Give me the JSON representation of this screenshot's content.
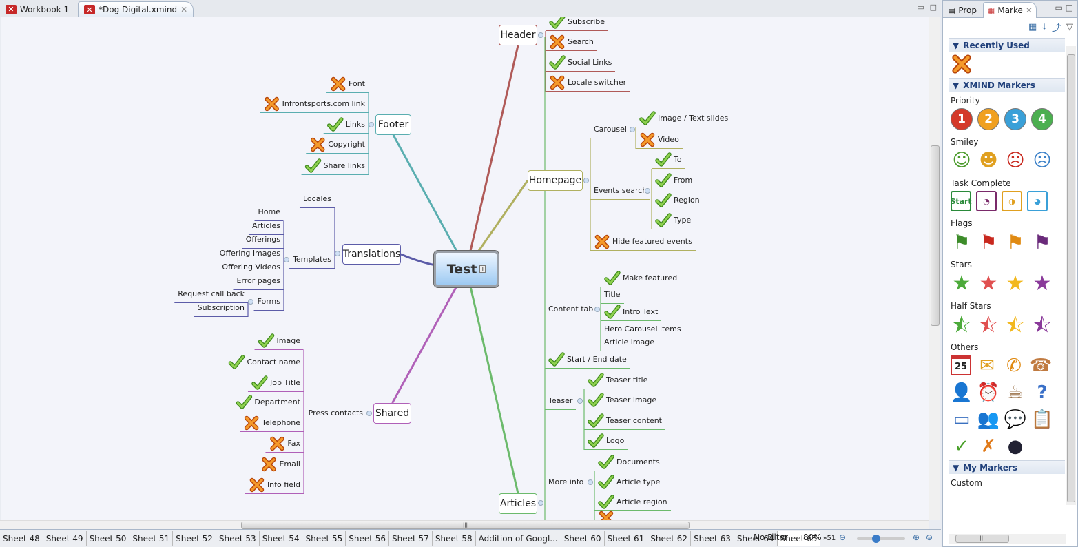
{
  "editor_tabs": [
    {
      "label": "Workbook 1",
      "active": false
    },
    {
      "label": "*Dog Digital.xmind",
      "active": true
    }
  ],
  "map": {
    "central": "Test",
    "branches": [
      {
        "id": "header",
        "label": "Header",
        "color": "#b05a58"
      },
      {
        "id": "footer",
        "label": "Footer",
        "color": "#5aaeb0"
      },
      {
        "id": "homepage",
        "label": "Homepage",
        "color": "#b0b060"
      },
      {
        "id": "translations",
        "label": "Translations",
        "color": "#5c5ca8"
      },
      {
        "id": "shared",
        "label": "Shared",
        "color": "#b060b8"
      },
      {
        "id": "articles",
        "label": "Articles",
        "color": "#6cba6c"
      }
    ],
    "nodes": {
      "h1": {
        "text": "Subscribe",
        "marker": "check"
      },
      "h2": {
        "text": "Search",
        "marker": "cross"
      },
      "h3": {
        "text": "Social Links",
        "marker": "check"
      },
      "h4": {
        "text": "Locale switcher",
        "marker": "cross"
      },
      "f1": {
        "text": "Font",
        "marker": "cross"
      },
      "f2": {
        "text": "Infrontsports.com link",
        "marker": "cross"
      },
      "f3": {
        "text": "Links",
        "marker": "check"
      },
      "f4": {
        "text": "Copyright",
        "marker": "cross"
      },
      "f5": {
        "text": "Share links",
        "marker": "check"
      },
      "hp_car": {
        "text": "Carousel",
        "marker": ""
      },
      "hp_c1": {
        "text": "Image / Text slides",
        "marker": "check"
      },
      "hp_c2": {
        "text": "Video",
        "marker": "cross"
      },
      "hp_ev": {
        "text": "Events search",
        "marker": ""
      },
      "hp_e1": {
        "text": "To",
        "marker": "check"
      },
      "hp_e2": {
        "text": "From",
        "marker": "check"
      },
      "hp_e3": {
        "text": "Region",
        "marker": "check"
      },
      "hp_e4": {
        "text": "Type",
        "marker": "check"
      },
      "hp_hide": {
        "text": "Hide featured events",
        "marker": "cross"
      },
      "t_loc": {
        "text": "Locales",
        "marker": ""
      },
      "t_tpl": {
        "text": "Templates",
        "marker": ""
      },
      "t1": {
        "text": "Home",
        "marker": ""
      },
      "t2": {
        "text": "Articles",
        "marker": ""
      },
      "t3": {
        "text": "Offerings",
        "marker": ""
      },
      "t4": {
        "text": "Offering Images",
        "marker": ""
      },
      "t5": {
        "text": "Offering Videos",
        "marker": ""
      },
      "t6": {
        "text": "Error pages",
        "marker": ""
      },
      "t_forms": {
        "text": "Forms",
        "marker": ""
      },
      "tf1": {
        "text": "Request call back",
        "marker": ""
      },
      "tf2": {
        "text": "Subscription",
        "marker": ""
      },
      "s_pc": {
        "text": "Press contacts",
        "marker": ""
      },
      "s1": {
        "text": "Image",
        "marker": "check"
      },
      "s2": {
        "text": "Contact name",
        "marker": "check"
      },
      "s3": {
        "text": "Job Title",
        "marker": "check"
      },
      "s4": {
        "text": "Department",
        "marker": "check"
      },
      "s5": {
        "text": "Telephone",
        "marker": "cross"
      },
      "s6": {
        "text": "Fax",
        "marker": "cross"
      },
      "s7": {
        "text": "Email",
        "marker": "cross"
      },
      "s8": {
        "text": "Info field",
        "marker": "cross"
      },
      "a_ct": {
        "text": "Content tab",
        "marker": ""
      },
      "a1": {
        "text": "Make featured",
        "marker": "check"
      },
      "a2": {
        "text": "Title",
        "marker": ""
      },
      "a3": {
        "text": "Intro Text",
        "marker": "check"
      },
      "a4": {
        "text": "Hero Carousel items",
        "marker": ""
      },
      "a5": {
        "text": "Article image",
        "marker": ""
      },
      "a_se": {
        "text": "Start / End date",
        "marker": "check"
      },
      "a_te": {
        "text": "Teaser",
        "marker": ""
      },
      "a6": {
        "text": "Teaser title",
        "marker": "check"
      },
      "a7": {
        "text": "Teaser image",
        "marker": "check"
      },
      "a8": {
        "text": "Teaser content",
        "marker": "check"
      },
      "a9": {
        "text": "Logo",
        "marker": "check"
      },
      "a_mi": {
        "text": "More info",
        "marker": ""
      },
      "a10": {
        "text": "Documents",
        "marker": "check"
      },
      "a11": {
        "text": "Article type",
        "marker": "check"
      },
      "a12": {
        "text": "Article region",
        "marker": "check"
      },
      "a13": {
        "text": "",
        "marker": "cross"
      }
    }
  },
  "sheet_tabs": [
    "Sheet 48",
    "Sheet 49",
    "Sheet 50",
    "Sheet 51",
    "Sheet 52",
    "Sheet 53",
    "Sheet 54",
    "Sheet 55",
    "Sheet 56",
    "Sheet 57",
    "Sheet 58",
    "Addition of Googl...",
    "Sheet 60",
    "Sheet 61",
    "Sheet 62",
    "Sheet 63",
    "Sheet 64",
    "Sheet 65"
  ],
  "active_sheet": "Sheet 65",
  "more_sheets": "51",
  "status": {
    "filter": "No Filter",
    "zoom": "80%",
    "zoom_level_percent": 80
  },
  "panel": {
    "tabs": [
      {
        "label": "Prop",
        "active": false
      },
      {
        "label": "Marke",
        "active": true
      }
    ],
    "sections": {
      "recent": "Recently Used",
      "xmind": "XMIND Markers",
      "mine": "My Markers"
    },
    "groups": {
      "priority": "Priority",
      "smiley": "Smiley",
      "task": "Task Complete",
      "flags": "Flags",
      "stars": "Stars",
      "half": "Half Stars",
      "others": "Others",
      "custom": "Custom"
    },
    "priority": [
      "1",
      "2",
      "3",
      "4"
    ],
    "priority_colors": [
      "#d43a2a",
      "#f0a020",
      "#3aa0d8",
      "#4caf50"
    ],
    "task_start": "Start",
    "flag_colors": [
      "#3d8c2a",
      "#c8281e",
      "#e08a12",
      "#6a2a7a"
    ],
    "star_colors": [
      "#4caa3a",
      "#e05050",
      "#f2b81e",
      "#8a3a9a"
    ],
    "calendar_day": "25"
  }
}
